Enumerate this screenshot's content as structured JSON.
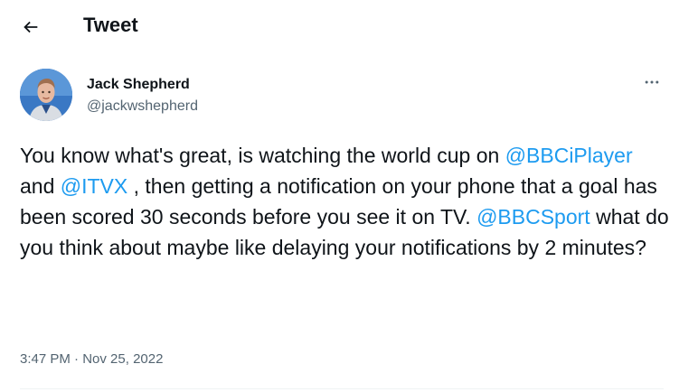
{
  "header": {
    "title": "Tweet"
  },
  "tweet": {
    "author_name": "Jack Shepherd",
    "author_handle": "@jackwshepherd",
    "text_segments": [
      "You know what's great, is watching the world cup on ",
      "@BBCiPlayer",
      "  and ",
      "@ITVX",
      " , then getting a notification on your phone that a goal has been scored 30 seconds before you see it on TV. ",
      "@BBCSport",
      " what do you think about maybe like delaying your notifications by 2 minutes?"
    ],
    "time": "3:47 PM",
    "separator": "·",
    "date": "Nov 25, 2022"
  },
  "icons": {
    "back": "arrow-left-icon",
    "more": "more-horizontal-icon"
  },
  "colors": {
    "text": "#0f1419",
    "secondary": "#536471",
    "link": "#1d9bf0",
    "divider": "#eff3f4"
  }
}
